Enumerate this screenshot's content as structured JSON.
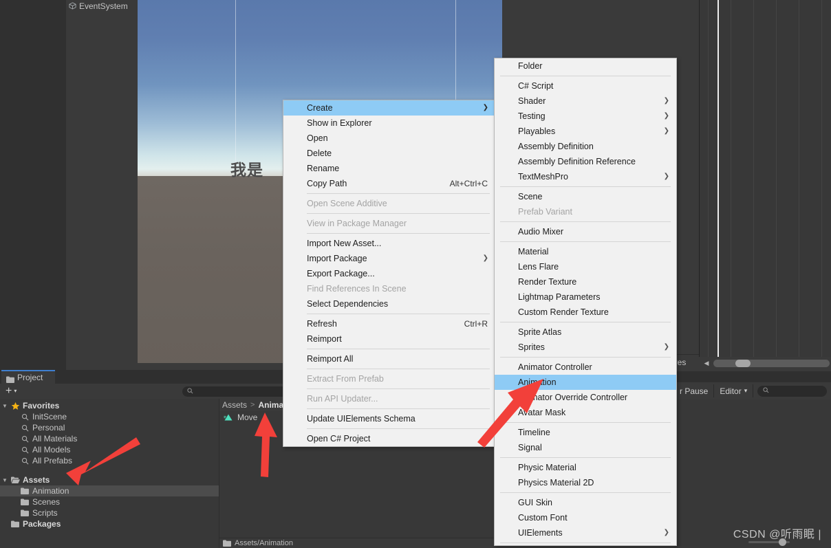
{
  "window": {
    "editor": "Unity Editor",
    "watermark": "CSDN @听雨眠 |"
  },
  "hierarchy": {
    "items": [
      {
        "label": "EventSystem",
        "icon": "cube-icon"
      }
    ]
  },
  "scene": {
    "text": "我是",
    "sky_top_color": "#5a79ac",
    "ground_color": "#6b645e"
  },
  "animation_window": {
    "curves_label": "urves",
    "scrollbar_left_arrow": "◀"
  },
  "console": {
    "error_pause_label": "r Pause",
    "editor_dropdown": "Editor",
    "dropdown_caret": "▾",
    "search_placeholder": ""
  },
  "project": {
    "tab_label": "Project",
    "tab_icon": "folder-icon",
    "add_button": "+",
    "add_caret": "▾",
    "search_placeholder": "",
    "search_icon": "search-icon",
    "tree": [
      {
        "label": "Favorites",
        "type": "group",
        "icon": "star-icon",
        "expanded": true,
        "indent": 0,
        "bold": true,
        "selected": false
      },
      {
        "label": "InitScene",
        "type": "search",
        "icon": "search-icon",
        "indent": 1,
        "bold": false,
        "selected": false
      },
      {
        "label": "Personal",
        "type": "search",
        "icon": "search-icon",
        "indent": 1,
        "bold": false,
        "selected": false
      },
      {
        "label": "All Materials",
        "type": "search",
        "icon": "search-icon",
        "indent": 1,
        "bold": false,
        "selected": false
      },
      {
        "label": "All Models",
        "type": "search",
        "icon": "search-icon",
        "indent": 1,
        "bold": false,
        "selected": false
      },
      {
        "label": "All Prefabs",
        "type": "search",
        "icon": "search-icon",
        "indent": 1,
        "bold": false,
        "selected": false
      },
      {
        "label": "",
        "type": "spacer",
        "icon": "",
        "indent": 0,
        "bold": false,
        "selected": false
      },
      {
        "label": "Assets",
        "type": "group",
        "icon": "folder-open-icon",
        "expanded": true,
        "indent": 0,
        "bold": true,
        "selected": false
      },
      {
        "label": "Animation",
        "type": "folder",
        "icon": "folder-icon",
        "indent": 1,
        "bold": false,
        "selected": true
      },
      {
        "label": "Scenes",
        "type": "folder",
        "icon": "folder-icon",
        "indent": 1,
        "bold": false,
        "selected": false
      },
      {
        "label": "Scripts",
        "type": "folder",
        "icon": "folder-icon",
        "indent": 1,
        "bold": false,
        "selected": false
      },
      {
        "label": "Packages",
        "type": "folder",
        "icon": "folder-icon",
        "indent": 0,
        "bold": true,
        "selected": false
      }
    ],
    "breadcrumb": {
      "root": "Assets",
      "separator": ">",
      "current": "Anima"
    },
    "assets": [
      {
        "label": "Move",
        "icon": "animation-clip-icon"
      }
    ],
    "status_path": "Assets/Animation"
  },
  "context_menu": {
    "items": [
      {
        "label": "Create",
        "shortcut": "",
        "submenu": true,
        "disabled": false,
        "selected": true
      },
      {
        "label": "Show in Explorer",
        "shortcut": "",
        "submenu": false,
        "disabled": false,
        "selected": false
      },
      {
        "label": "Open",
        "shortcut": "",
        "submenu": false,
        "disabled": false,
        "selected": false
      },
      {
        "label": "Delete",
        "shortcut": "",
        "submenu": false,
        "disabled": false,
        "selected": false
      },
      {
        "label": "Rename",
        "shortcut": "",
        "submenu": false,
        "disabled": false,
        "selected": false
      },
      {
        "label": "Copy Path",
        "shortcut": "Alt+Ctrl+C",
        "submenu": false,
        "disabled": false,
        "selected": false
      },
      {
        "label": "--sep--"
      },
      {
        "label": "Open Scene Additive",
        "shortcut": "",
        "submenu": false,
        "disabled": true,
        "selected": false
      },
      {
        "label": "--sep--"
      },
      {
        "label": "View in Package Manager",
        "shortcut": "",
        "submenu": false,
        "disabled": true,
        "selected": false
      },
      {
        "label": "--sep--"
      },
      {
        "label": "Import New Asset...",
        "shortcut": "",
        "submenu": false,
        "disabled": false,
        "selected": false
      },
      {
        "label": "Import Package",
        "shortcut": "",
        "submenu": true,
        "disabled": false,
        "selected": false
      },
      {
        "label": "Export Package...",
        "shortcut": "",
        "submenu": false,
        "disabled": false,
        "selected": false
      },
      {
        "label": "Find References In Scene",
        "shortcut": "",
        "submenu": false,
        "disabled": true,
        "selected": false
      },
      {
        "label": "Select Dependencies",
        "shortcut": "",
        "submenu": false,
        "disabled": false,
        "selected": false
      },
      {
        "label": "--sep--"
      },
      {
        "label": "Refresh",
        "shortcut": "Ctrl+R",
        "submenu": false,
        "disabled": false,
        "selected": false
      },
      {
        "label": "Reimport",
        "shortcut": "",
        "submenu": false,
        "disabled": false,
        "selected": false
      },
      {
        "label": "--sep--"
      },
      {
        "label": "Reimport All",
        "shortcut": "",
        "submenu": false,
        "disabled": false,
        "selected": false
      },
      {
        "label": "--sep--"
      },
      {
        "label": "Extract From Prefab",
        "shortcut": "",
        "submenu": false,
        "disabled": true,
        "selected": false
      },
      {
        "label": "--sep--"
      },
      {
        "label": "Run API Updater...",
        "shortcut": "",
        "submenu": false,
        "disabled": true,
        "selected": false
      },
      {
        "label": "--sep--"
      },
      {
        "label": "Update UIElements Schema",
        "shortcut": "",
        "submenu": false,
        "disabled": false,
        "selected": false
      },
      {
        "label": "--sep--"
      },
      {
        "label": "Open C# Project",
        "shortcut": "",
        "submenu": false,
        "disabled": false,
        "selected": false
      }
    ]
  },
  "create_submenu": {
    "items": [
      {
        "label": "Folder",
        "submenu": false,
        "disabled": false,
        "selected": false
      },
      {
        "label": "--sep--"
      },
      {
        "label": "C# Script",
        "submenu": false,
        "disabled": false,
        "selected": false
      },
      {
        "label": "Shader",
        "submenu": true,
        "disabled": false,
        "selected": false
      },
      {
        "label": "Testing",
        "submenu": true,
        "disabled": false,
        "selected": false
      },
      {
        "label": "Playables",
        "submenu": true,
        "disabled": false,
        "selected": false
      },
      {
        "label": "Assembly Definition",
        "submenu": false,
        "disabled": false,
        "selected": false
      },
      {
        "label": "Assembly Definition Reference",
        "submenu": false,
        "disabled": false,
        "selected": false
      },
      {
        "label": "TextMeshPro",
        "submenu": true,
        "disabled": false,
        "selected": false
      },
      {
        "label": "--sep--"
      },
      {
        "label": "Scene",
        "submenu": false,
        "disabled": false,
        "selected": false
      },
      {
        "label": "Prefab Variant",
        "submenu": false,
        "disabled": true,
        "selected": false
      },
      {
        "label": "--sep--"
      },
      {
        "label": "Audio Mixer",
        "submenu": false,
        "disabled": false,
        "selected": false
      },
      {
        "label": "--sep--"
      },
      {
        "label": "Material",
        "submenu": false,
        "disabled": false,
        "selected": false
      },
      {
        "label": "Lens Flare",
        "submenu": false,
        "disabled": false,
        "selected": false
      },
      {
        "label": "Render Texture",
        "submenu": false,
        "disabled": false,
        "selected": false
      },
      {
        "label": "Lightmap Parameters",
        "submenu": false,
        "disabled": false,
        "selected": false
      },
      {
        "label": "Custom Render Texture",
        "submenu": false,
        "disabled": false,
        "selected": false
      },
      {
        "label": "--sep--"
      },
      {
        "label": "Sprite Atlas",
        "submenu": false,
        "disabled": false,
        "selected": false
      },
      {
        "label": "Sprites",
        "submenu": true,
        "disabled": false,
        "selected": false
      },
      {
        "label": "--sep--"
      },
      {
        "label": "Animator Controller",
        "submenu": false,
        "disabled": false,
        "selected": false
      },
      {
        "label": "Animation",
        "submenu": false,
        "disabled": false,
        "selected": true
      },
      {
        "label": "Animator Override Controller",
        "submenu": false,
        "disabled": false,
        "selected": false
      },
      {
        "label": "Avatar Mask",
        "submenu": false,
        "disabled": false,
        "selected": false
      },
      {
        "label": "--sep--"
      },
      {
        "label": "Timeline",
        "submenu": false,
        "disabled": false,
        "selected": false
      },
      {
        "label": "Signal",
        "submenu": false,
        "disabled": false,
        "selected": false
      },
      {
        "label": "--sep--"
      },
      {
        "label": "Physic Material",
        "submenu": false,
        "disabled": false,
        "selected": false
      },
      {
        "label": "Physics Material 2D",
        "submenu": false,
        "disabled": false,
        "selected": false
      },
      {
        "label": "--sep--"
      },
      {
        "label": "GUI Skin",
        "submenu": false,
        "disabled": false,
        "selected": false
      },
      {
        "label": "Custom Font",
        "submenu": false,
        "disabled": false,
        "selected": false
      },
      {
        "label": "UIElements",
        "submenu": true,
        "disabled": false,
        "selected": false
      },
      {
        "label": "--sep--"
      }
    ]
  },
  "annotations": {
    "arrow_color": "#f2403a",
    "arrows": [
      {
        "name": "arrow-to-animation-folder"
      },
      {
        "name": "arrow-to-move-clip"
      },
      {
        "name": "arrow-to-animation-menu-item"
      }
    ]
  }
}
